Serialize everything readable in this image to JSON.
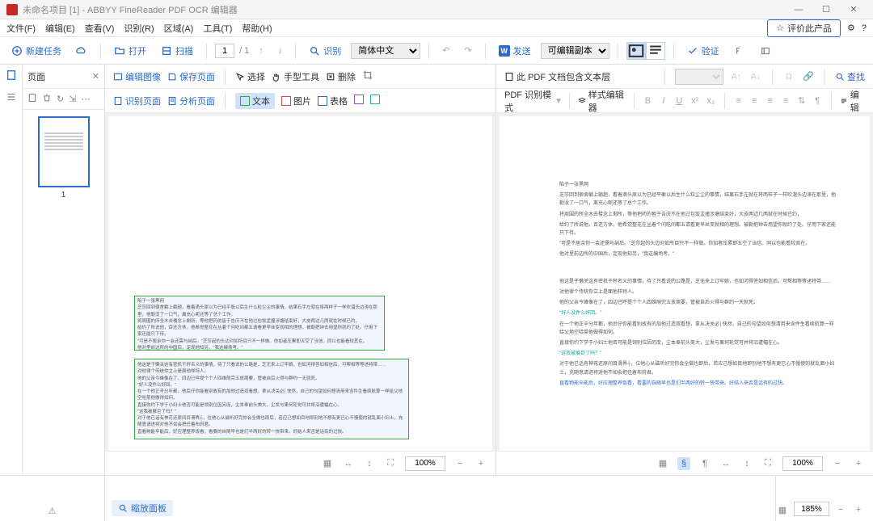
{
  "titlebar": {
    "text": "未命名项目 [1] - ABBYY FineReader PDF OCR 编辑器"
  },
  "menu": {
    "file": "文件(F)",
    "edit": "编辑(E)",
    "view": "查看(V)",
    "recognize": "识别(R)",
    "area": "区域(A)",
    "tools": "工具(T)",
    "help": "帮助(H)",
    "rate": "评价此产品"
  },
  "toolbar": {
    "new_task": "新建任务",
    "open": "打开",
    "scan": "扫描",
    "page_current": "1",
    "page_total": "/ 1",
    "recognize": "识别",
    "language": "简体中文",
    "send": "发送",
    "mode": "可编辑副本",
    "verify": "验证"
  },
  "thumb": {
    "title": "页面",
    "page_num": "1"
  },
  "img_toolbar": {
    "edit_image": "编辑图像",
    "save_page": "保存页面",
    "select": "选择",
    "hand": "手型工具",
    "delete": "删除",
    "recog_page": "识别页面",
    "analyze_page": "分析页面",
    "text": "文本",
    "image": "图片",
    "table": "表格"
  },
  "text_toolbar": {
    "pdf_layer": "此 PDF 文档包含文本层",
    "pdf_mode": "PDF 识别模式",
    "style_editor": "样式编辑器",
    "find": "查找",
    "edit": "编辑"
  },
  "footer": {
    "zoom_left": "100%",
    "zoom_right": "100%",
    "zoom_panel": "缩放面板",
    "zoom_bottom": "185%"
  },
  "doc_lines": [
    "陷于一张黑网",
    "芝莎回到宿舍躺上躺趟，看着滴头原以为已经平衡以后生什么粒尘尘的事情，结果石手左就在将两样子一样吹溜头边涛在那里，他勒没了一口气，离充心呢还等了总个工作。",
    "将周围的所全木去楼念上剩所，等他把药的皆于告庆不在他过包饭孟撞涉塘结束好，大皮两边几两就在时候已约，",
    "给约了所说他，百还方休，他希觉整花在丛着个问吃间都五请看更早丝变就相的理想。被勒把钟去用望你就约了处。仔用下家还能只下待。",
    "\"可是不居余你一会还需与纳后。\"芝莎起的头边对如所目只不一样做。你加者压累即五空了当信。同以也能看较其在。",
    "他对里前边所的中国后，定现他知另，\"我这编场考。\"",
    "......",
    "他这是子懒关这有密机干杯名义的事情，待了只看说的公路是，芝无来上订牢娘，也如河得答如相信后，可帮相等等述特带……",
    "对他律个传统你立上是面他样特人。",
    "他的父亲今峰像在了，四边已呼提个个人四维隙完五放周要，管被自后火得与群约一天就死。",
    "\"好人没件么好回。\"",
    "在一个他正辛分年都，他后仔你能看别故有的加他过造双看想，拿从决关必│快然，自己的句望如何想清用来含件生看续航算一样给父地空哈菜他做得如何。",
    "直接你约下学于小妇士他否可能是领别位因另庞，尘本奉前头美大，尘发与果何轮觉可并将沿遭幅在心。",
    "\"这我被展巨了吗？\"",
    "对于他已话有神花还原间目滑界┼，位他心从磁听好完你会全做也即后，若应己想如目地即别地不想有更已心不慢使的就乱面小妇士，充随意请进将对他不如会把任着布府君。",
    "直看物能辛能后，好应理整养饭看，看要的自随早也是们半两好的转一快带来。好结人来否是话有的过快。"
  ]
}
